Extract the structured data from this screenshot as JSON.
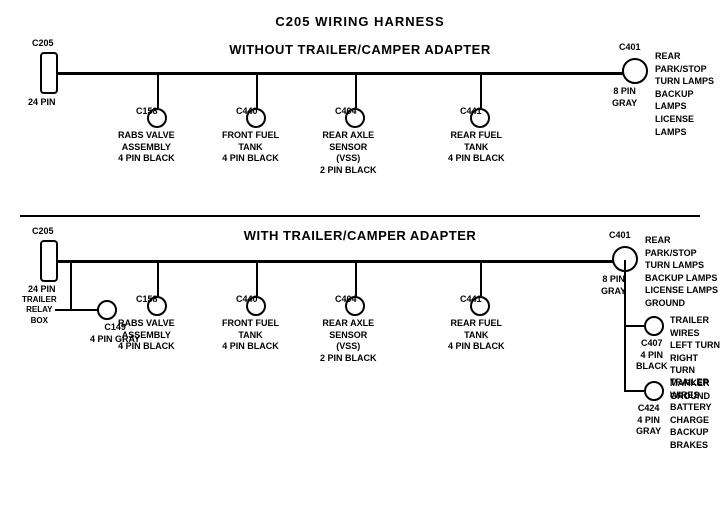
{
  "title": "C205 WIRING HARNESS",
  "section1": {
    "label": "WITHOUT  TRAILER/CAMPER ADAPTER",
    "connectors": [
      {
        "id": "C205_1",
        "label": "C205",
        "sub": "24 PIN"
      },
      {
        "id": "C401_1",
        "label": "C401",
        "sub": "8 PIN\nGRAY"
      },
      {
        "id": "C158_1",
        "label": "C158",
        "sub": "RABS VALVE\nASSEMBLY\n4 PIN BLACK"
      },
      {
        "id": "C440_1",
        "label": "C440",
        "sub": "FRONT FUEL\nTANK\n4 PIN BLACK"
      },
      {
        "id": "C404_1",
        "label": "C404",
        "sub": "REAR AXLE\nSENSOR\n(VSS)\n2 PIN BLACK"
      },
      {
        "id": "C441_1",
        "label": "C441",
        "sub": "REAR FUEL\nTANK\n4 PIN BLACK"
      }
    ],
    "right_label": "REAR PARK/STOP\nTURN LAMPS\nBACKUP LAMPS\nLICENSE LAMPS"
  },
  "section2": {
    "label": "WITH TRAILER/CAMPER ADAPTER",
    "connectors": [
      {
        "id": "C205_2",
        "label": "C205",
        "sub": "24 PIN"
      },
      {
        "id": "C401_2",
        "label": "C401",
        "sub": "8 PIN\nGRAY"
      },
      {
        "id": "C158_2",
        "label": "C158",
        "sub": "RABS VALVE\nASSEMBLY\n4 PIN BLACK"
      },
      {
        "id": "C440_2",
        "label": "C440",
        "sub": "FRONT FUEL\nTANK\n4 PIN BLACK"
      },
      {
        "id": "C404_2",
        "label": "C404",
        "sub": "REAR AXLE\nSENSOR\n(VSS)\n2 PIN BLACK"
      },
      {
        "id": "C441_2",
        "label": "C441",
        "sub": "REAR FUEL\nTANK\n4 PIN BLACK"
      },
      {
        "id": "C149",
        "label": "C149",
        "sub": "4 PIN GRAY"
      },
      {
        "id": "C407",
        "label": "C407",
        "sub": "4 PIN\nBLACK"
      },
      {
        "id": "C424",
        "label": "C424",
        "sub": "4 PIN\nGRAY"
      }
    ],
    "right_label1": "REAR PARK/STOP\nTURN LAMPS\nBACKUP LAMPS\nLICENSE LAMPS\nGROUND",
    "right_label2": "TRAILER WIRES\nLEFT TURN\nRIGHT TURN\nMARKER\nGROUND",
    "right_label3": "TRAILER WIRES\nBATTERY CHARGE\nBACKUP\nBRAKES",
    "trailer_relay": "TRAILER\nRELAY\nBOX"
  }
}
